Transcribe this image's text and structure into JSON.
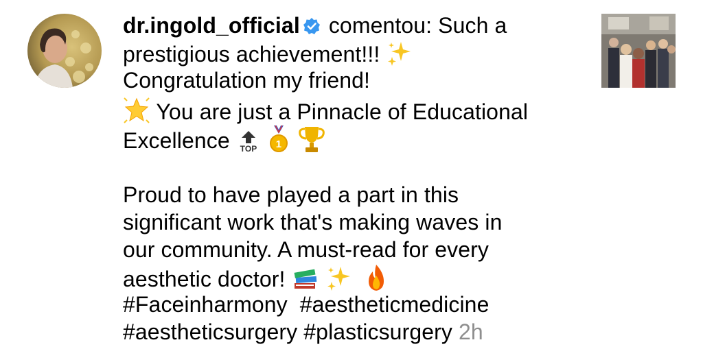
{
  "comment": {
    "username": "dr.ingold_official",
    "verb": "comentou: Such a",
    "line2": "prestigious achievement!!!",
    "line3": "Congratulation my friend!",
    "line4": "You are just a Pinnacle of Educational",
    "line5": "Excellence",
    "line6": "Proud to have played a part in this",
    "line7": "significant work that's making waves in",
    "line8": "our community. A must-read for every",
    "line9": "aesthetic doctor!",
    "hashtags": [
      "#Faceinharmony",
      "#aestheticmedicine",
      "#aestheticsurgery",
      "#plasticsurgery"
    ],
    "timestamp": "2h"
  },
  "icons": {
    "verified": "verified-badge-icon",
    "sparkles": "sparkles-emoji",
    "star": "glowing-star-emoji",
    "top": "top-arrow-emoji",
    "medal": "first-place-medal-emoji",
    "trophy": "trophy-emoji",
    "books": "books-emoji",
    "fire": "fire-emoji"
  },
  "colors": {
    "verified": "#3897f0",
    "timestamp": "#8e8e8e",
    "text": "#000000"
  }
}
